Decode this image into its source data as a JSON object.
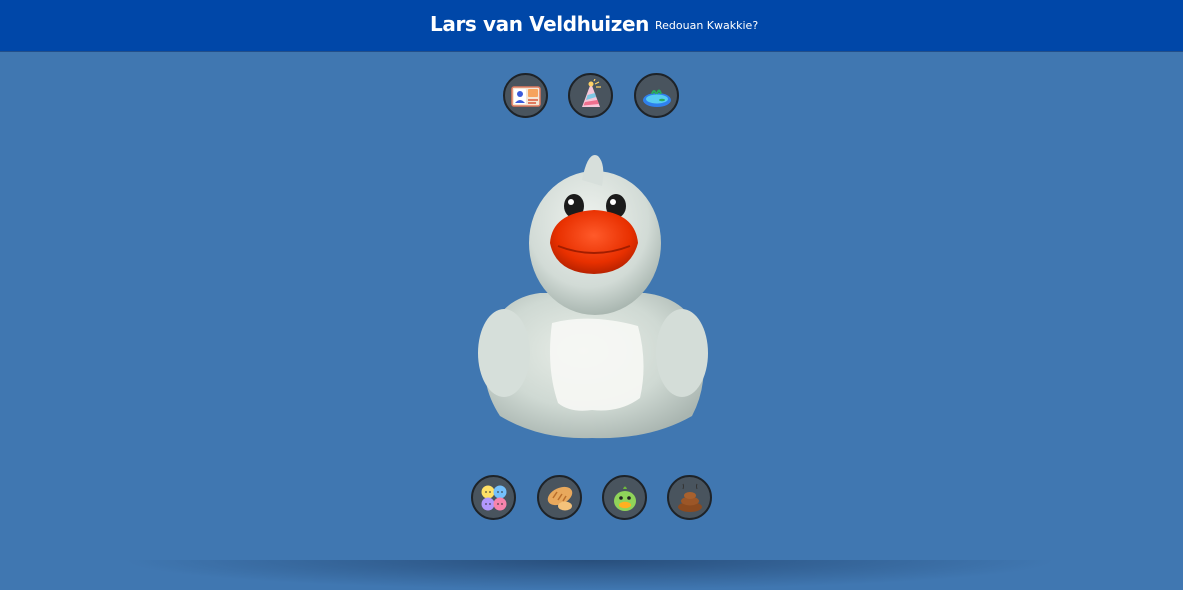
{
  "header": {
    "title": "Lars van Veldhuizen",
    "subtitle": "Redouan Kwakkie?"
  },
  "top_actions": [
    {
      "icon": "id-card-icon"
    },
    {
      "icon": "party-hat-icon"
    },
    {
      "icon": "pond-icon"
    }
  ],
  "bottom_actions": [
    {
      "icon": "moods-icon"
    },
    {
      "icon": "bread-icon"
    },
    {
      "icon": "duck-face-icon"
    },
    {
      "icon": "poop-icon"
    }
  ],
  "colors": {
    "background": "#4077b1",
    "header": "#0047a8",
    "button": "#49545e"
  }
}
